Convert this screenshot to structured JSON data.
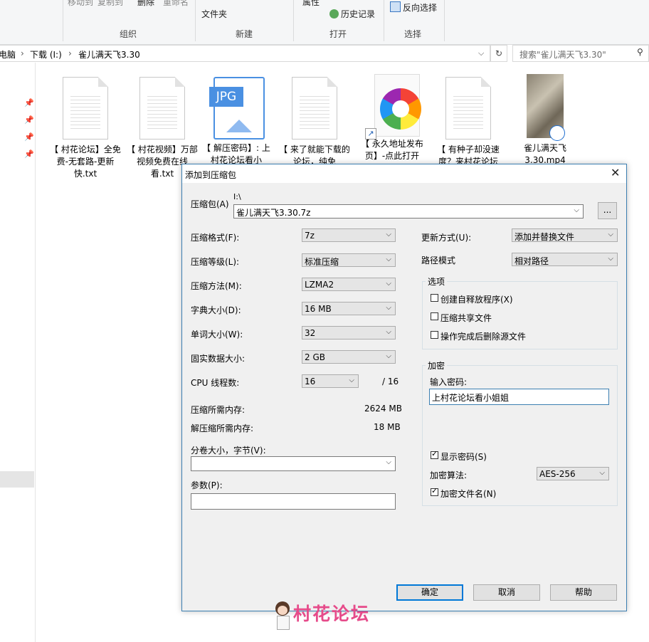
{
  "ribbon": {
    "move_to": "移动到",
    "copy_to": "复制到",
    "delete": "删除",
    "rename": "重命名",
    "new_folder": "文件夹",
    "properties": "属性",
    "history": "历史记录",
    "invert_select": "反向选择",
    "group_organize": "组织",
    "group_new": "新建",
    "group_open": "打开",
    "group_select": "选择"
  },
  "address": {
    "seg1": "电脑",
    "seg2": "下载 (I:)",
    "seg3": "雀儿满天飞3.30",
    "search_placeholder": "搜索\"雀儿满天飞3.30\""
  },
  "files": [
    {
      "name": "【 村花论坛】全免费-无套路-更新快.txt",
      "icon": "text-file-icon"
    },
    {
      "name": "【 村花视频】万部视频免费在线看.txt",
      "icon": "text-file-icon"
    },
    {
      "name": "【 解压密码】: 上村花论坛看小",
      "icon": "jpg-file-icon"
    },
    {
      "name": "【 来了就能下载的论坛，纯免",
      "icon": "text-file-icon"
    },
    {
      "name": "【 永久地址发布页】-点此打开",
      "icon": "browser-shortcut-icon"
    },
    {
      "name": "【 有种子却没速度？来村花论坛",
      "icon": "text-file-icon"
    },
    {
      "name": "雀儿满天飞3.30.mp4",
      "icon": "video-thumbnail-icon"
    }
  ],
  "dialog": {
    "title": "添加到压缩包",
    "archive_label": "压缩包(A)",
    "archive_dir": "I:\\",
    "archive_name": "雀儿满天飞3.30.7z",
    "browse": "...",
    "format_label": "压缩格式(F):",
    "format_value": "7z",
    "level_label": "压缩等级(L):",
    "level_value": "标准压缩",
    "method_label": "压缩方法(M):",
    "method_value": "LZMA2",
    "dict_label": "字典大小(D):",
    "dict_value": "16 MB",
    "word_label": "单词大小(W):",
    "word_value": "32",
    "solid_label": "固实数据大小:",
    "solid_value": "2 GB",
    "cpu_label": "CPU 线程数:",
    "cpu_value": "16",
    "cpu_max": "/ 16",
    "mem_compress_label": "压缩所需内存:",
    "mem_compress_value": "2624 MB",
    "mem_decompress_label": "解压缩所需内存:",
    "mem_decompress_value": "18 MB",
    "volume_label": "分卷大小，字节(V):",
    "params_label": "参数(P):",
    "update_label": "更新方式(U):",
    "update_value": "添加并替换文件",
    "path_label": "路径模式",
    "path_value": "相对路径",
    "options_title": "选项",
    "opt_sfx": "创建自释放程序(X)",
    "opt_shared": "压缩共享文件",
    "opt_delete": "操作完成后删除源文件",
    "enc_title": "加密",
    "password_label": "输入密码:",
    "password_value": "上村花论坛看小姐姐",
    "show_password": "显示密码(S)",
    "enc_method_label": "加密算法:",
    "enc_method_value": "AES-256",
    "encrypt_names": "加密文件名(N)",
    "ok": "确定",
    "cancel": "取消",
    "help": "帮助"
  },
  "watermark": "村花论坛"
}
